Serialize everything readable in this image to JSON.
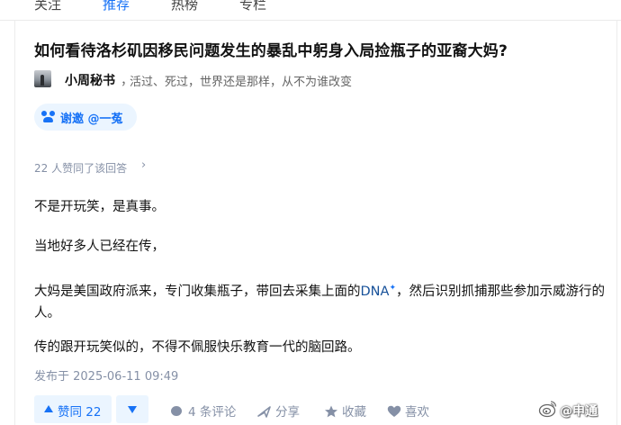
{
  "nav": {
    "tabs": [
      {
        "label": "关注"
      },
      {
        "label": "推荐"
      },
      {
        "label": "热榜"
      },
      {
        "label": "专栏"
      }
    ]
  },
  "question": {
    "title": "如何看待洛杉矶因移民问题发生的暴乱中躬身入局捡瓶子的亚裔大妈?"
  },
  "author": {
    "name": "小周秘书",
    "separator": "，",
    "bio": "活过、死过，世界还是那样，从不为谁改变"
  },
  "invite": {
    "label": "谢邀 @一菟"
  },
  "answer": {
    "likes_summary": "22 人赞同了该回答",
    "likes_chevron": "›",
    "paragraphs": {
      "p1": "不是开玩笑，是真事。",
      "p2": "当地好多人已经在传，",
      "p3_before": "大妈是美国政府派来，专门收集瓶子，带回去采集上面的",
      "p3_link": "DNA",
      "p3_plus": "✦",
      "p3_after": "，然后识别抓捕那些参加示威游行的人。",
      "p4": "传的跟开玩笑似的，不得不佩服快乐教育一代的脑回路。"
    },
    "published": "发布于 2025-06-11 09:49"
  },
  "actions": {
    "upvote_label": "赞同 22",
    "comment_label": "4 条评论",
    "share_label": "分享",
    "favorite_label": "收藏",
    "like_label": "喜欢"
  },
  "watermark": {
    "text": "@申通"
  },
  "colors": {
    "accent": "#1772f6",
    "accent_bg": "#ebf5ff",
    "meta": "#8590a6",
    "link": "#175199"
  }
}
